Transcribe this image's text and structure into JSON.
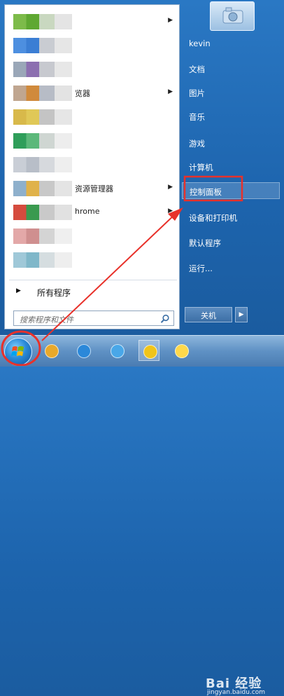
{
  "user": {
    "name": "kevin"
  },
  "left_panel": {
    "programs": [
      {
        "label": "",
        "has_arrow": true,
        "colors": [
          "#7dbb4a",
          "#5fa832",
          "#c9d8c0",
          "#e4e4e4"
        ]
      },
      {
        "label": "",
        "has_arrow": false,
        "colors": [
          "#4d8fe0",
          "#3b7ed4",
          "#c9ccd2",
          "#e6e6e6"
        ]
      },
      {
        "label": "",
        "has_arrow": false,
        "colors": [
          "#9aa7b8",
          "#8c6fb0",
          "#c7c9cf",
          "#e7e7e7"
        ]
      },
      {
        "label": "览器",
        "has_arrow": true,
        "colors": [
          "#c0a690",
          "#d08a3c",
          "#b7bcc6",
          "#e3e3e3"
        ]
      },
      {
        "label": "",
        "has_arrow": false,
        "colors": [
          "#d8b94a",
          "#e0c857",
          "#c4c4c4",
          "#e6e6e6"
        ]
      },
      {
        "label": "",
        "has_arrow": false,
        "colors": [
          "#2f9e5a",
          "#5cb87a",
          "#cfd6d2",
          "#ededed"
        ]
      },
      {
        "label": "",
        "has_arrow": false,
        "colors": [
          "#c9ced6",
          "#b8bec8",
          "#d6d9dd",
          "#eeeeee"
        ]
      },
      {
        "label": "资源管理器",
        "has_arrow": true,
        "colors": [
          "#8eb0cc",
          "#e0b24a",
          "#c8c8c8",
          "#e4e4e4"
        ]
      },
      {
        "label": "hrome",
        "has_arrow": true,
        "colors": [
          "#d54b3e",
          "#3a9a4f",
          "#c9c9c9",
          "#e1e1e1"
        ]
      },
      {
        "label": "",
        "has_arrow": false,
        "colors": [
          "#e3a8a8",
          "#cf8f8f",
          "#d4d4d4",
          "#efefef"
        ]
      },
      {
        "label": "",
        "has_arrow": false,
        "colors": [
          "#9fc8d8",
          "#7fb7c9",
          "#d5dde0",
          "#eeeeee"
        ]
      }
    ],
    "all_programs_label": "所有程序",
    "search_placeholder": "搜索程序和文件"
  },
  "right_panel": {
    "items": [
      {
        "label": "kevin",
        "active": false
      },
      {
        "label": "文档",
        "active": false
      },
      {
        "label": "图片",
        "active": false
      },
      {
        "label": "音乐",
        "active": false
      },
      {
        "label": "游戏",
        "active": false
      },
      {
        "label": "计算机",
        "active": false
      },
      {
        "label": "控制面板",
        "active": true
      },
      {
        "label": "设备和打印机",
        "active": false
      },
      {
        "label": "默认程序",
        "active": false
      },
      {
        "label": "运行...",
        "active": false
      }
    ],
    "shutdown_label": "关机"
  },
  "taskbar": {
    "buttons": [
      {
        "name": "explorer-icon",
        "color": "#e9a92b"
      },
      {
        "name": "ie-icon",
        "color": "#2b88d9"
      },
      {
        "name": "qq-icon",
        "color": "#49a7e8"
      },
      {
        "name": "media-icon",
        "color": "#f0c419"
      },
      {
        "name": "weather-icon",
        "color": "#ffd84a"
      }
    ]
  },
  "watermark": {
    "logo": "Bai 经验",
    "url": "jingyan.baidu.com"
  },
  "colors": {
    "annotation_red": "#e8312a",
    "accent_blue": "#2a78c4"
  }
}
